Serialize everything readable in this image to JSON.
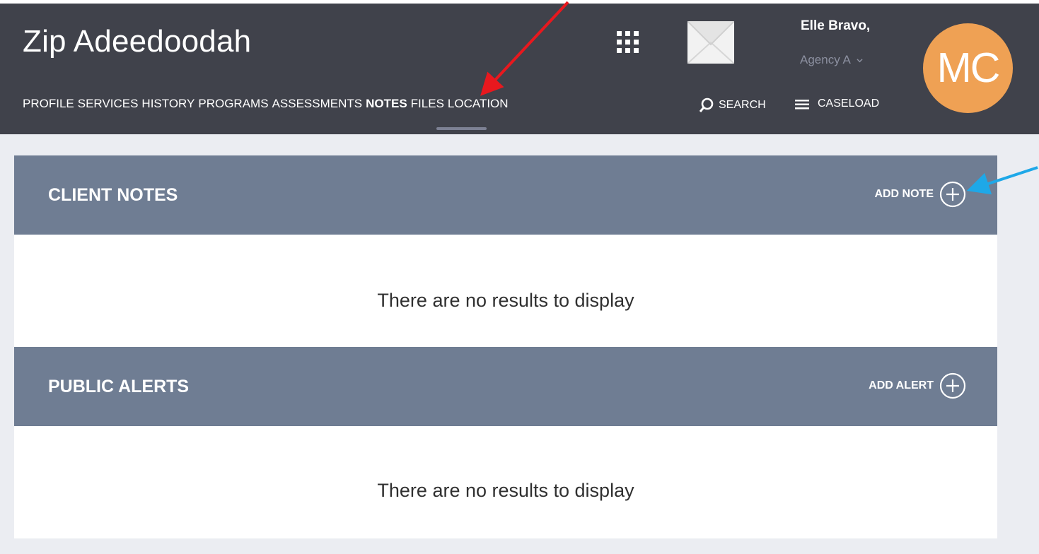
{
  "header": {
    "client_name": "Zip Adeedoodah",
    "tabs": [
      {
        "label": "PROFILE"
      },
      {
        "label": "SERVICES"
      },
      {
        "label": "HISTORY"
      },
      {
        "label": "PROGRAMS"
      },
      {
        "label": "ASSESSMENTS"
      },
      {
        "label": "NOTES"
      },
      {
        "label": "FILES"
      },
      {
        "label": "LOCATION"
      }
    ],
    "active_tab": "NOTES",
    "user_name": "Elle Bravo,",
    "agency": "Agency A",
    "avatar_initials": "MC",
    "search_label": "SEARCH",
    "caseload_label": "CASELOAD",
    "icons": [
      "apps-grid-icon",
      "mail-icon",
      "chevron-down-icon",
      "search-icon",
      "menu-icon"
    ]
  },
  "panels": {
    "client_notes": {
      "title": "CLIENT NOTES",
      "action_label": "ADD NOTE",
      "empty_text": "There are no results to display"
    },
    "public_alerts": {
      "title": "PUBLIC ALERTS",
      "action_label": "ADD ALERT",
      "empty_text": "There are no results to display"
    }
  },
  "colors": {
    "header_bg": "#40424b",
    "page_bg": "#ebedf2",
    "panel_header_bg": "#6f7d93",
    "avatar_bg": "#efa154",
    "annotation_red": "#e8181e",
    "annotation_blue": "#1ea8e8"
  }
}
